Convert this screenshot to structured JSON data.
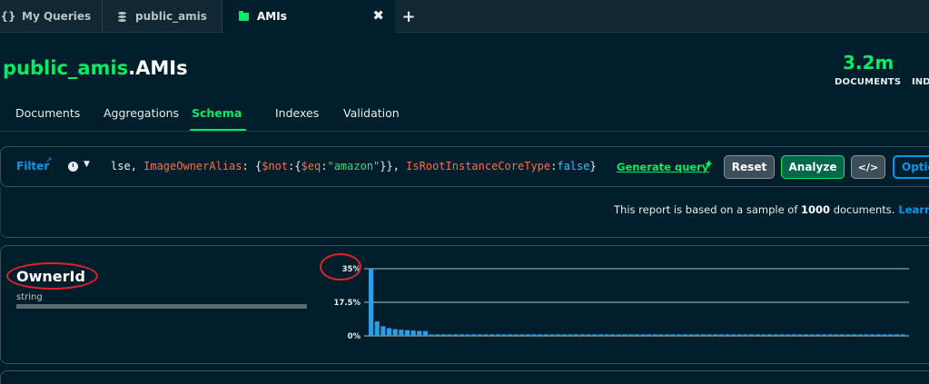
{
  "tabs": [
    {
      "label": "My Queries",
      "icon": "braces-icon"
    },
    {
      "label": "public_amis",
      "icon": "database-icon"
    },
    {
      "label": "AMIs",
      "icon": "folder-icon",
      "active": true
    }
  ],
  "header": {
    "db": "public_amis",
    "collection": ".AMIs",
    "documents_count": "3.2m",
    "documents_label": "DOCUMENTS",
    "indexes_label": "IND"
  },
  "subtabs": [
    "Documents",
    "Aggregations",
    "Schema",
    "Indexes",
    "Validation"
  ],
  "active_subtab": "Schema",
  "filter": {
    "label": "Filter",
    "query_tokens": [
      {
        "t": "lse, ",
        "c": "plain"
      },
      {
        "t": "ImageOwnerAlias",
        "c": "key"
      },
      {
        "t": ": {",
        "c": "plain"
      },
      {
        "t": "$not",
        "c": "op"
      },
      {
        "t": ":{",
        "c": "plain"
      },
      {
        "t": "$eq",
        "c": "op"
      },
      {
        "t": ":",
        "c": "plain"
      },
      {
        "t": "\"amazon\"",
        "c": "str"
      },
      {
        "t": "}}, ",
        "c": "plain"
      },
      {
        "t": "IsRootInstanceCoreType",
        "c": "key"
      },
      {
        "t": ":",
        "c": "plain"
      },
      {
        "t": "false",
        "c": "bool"
      },
      {
        "t": "}",
        "c": "plain"
      }
    ],
    "generate_query": "Generate query",
    "reset": "Reset",
    "analyze": "Analyze",
    "code": "</>",
    "options": "Optio"
  },
  "sample": {
    "prefix": "This report is based on a sample of ",
    "count": "1000",
    "suffix": " documents.",
    "learn": "Learn"
  },
  "field": {
    "name": "OwnerId",
    "type": "string"
  },
  "chart_data": {
    "type": "bar",
    "ytick_labels": [
      "35%",
      "17.5%",
      "0%"
    ],
    "ylim": [
      0,
      35
    ],
    "values": [
      35,
      7.5,
      5,
      4,
      3.5,
      3.2,
      3,
      2.8,
      2.6,
      2.5,
      0.8,
      0.8,
      0.8,
      0.8,
      0.8,
      0.8,
      0.8,
      0.8,
      0.8,
      0.8,
      0.8,
      0.8,
      0.8,
      0.8,
      0.8,
      0.8,
      0.8,
      0.8,
      0.8,
      0.8,
      0.8,
      0.8,
      0.8,
      0.8,
      0.8,
      0.8,
      0.8,
      0.8,
      0.8,
      0.8,
      0.8,
      0.8,
      0.8,
      0.8,
      0.8,
      0.8,
      0.8,
      0.8,
      0.8,
      0.8,
      0.8,
      0.8,
      0.8,
      0.8,
      0.8,
      0.8,
      0.8,
      0.8,
      0.8,
      0.8,
      0.8,
      0.8,
      0.8,
      0.8,
      0.8,
      0.8,
      0.8,
      0.8,
      0.8,
      0.8,
      0.8,
      0.8,
      0.8,
      0.8,
      0.8,
      0.8,
      0.8,
      0.8,
      0.8,
      0.8,
      0.8,
      0.8,
      0.8,
      0.8,
      0.8,
      0.8,
      0.8,
      0.8,
      0.8
    ],
    "grid": true,
    "bar_color": "#2f9ee0"
  },
  "colors": {
    "accent": "#00ed64",
    "link": "#0498ec",
    "background": "#001e2b",
    "annotation": "#e0232f"
  }
}
